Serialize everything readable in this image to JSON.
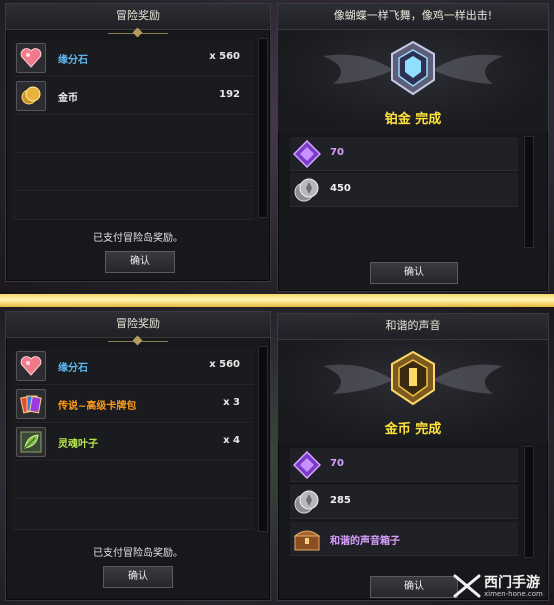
{
  "top_left": {
    "title": "冒险奖励",
    "items": [
      {
        "name": "缘分石",
        "qty": "x 560",
        "icon": "heart-stone-icon"
      },
      {
        "name": "金币",
        "qty": "192",
        "icon": "gold-coin-icon"
      }
    ],
    "paid_text": "已支付冒险岛奖励。",
    "confirm_label": "确认"
  },
  "top_right": {
    "title": "像蝴蝶一样飞舞，像鸡一样出击!",
    "rank_label": "铂金 完成",
    "rewards": [
      {
        "value": "70",
        "icon": "purple-crystal-icon"
      },
      {
        "value": "450",
        "icon": "silver-coin-icon"
      }
    ],
    "confirm_label": "确认"
  },
  "bottom_left": {
    "title": "冒险奖励",
    "items": [
      {
        "name": "缘分石",
        "qty": "x 560",
        "icon": "heart-stone-icon"
      },
      {
        "name": "传说~高级卡牌包",
        "qty": "x 3",
        "icon": "card-pack-icon"
      },
      {
        "name": "灵魂叶子",
        "qty": "x 4",
        "icon": "soul-leaf-icon"
      }
    ],
    "paid_text": "已支付冒险岛奖励。",
    "confirm_label": "确认"
  },
  "bottom_right": {
    "title": "和谐的声音",
    "rank_label": "金币 完成",
    "rewards": [
      {
        "value": "70",
        "icon": "purple-crystal-icon"
      },
      {
        "value": "285",
        "icon": "silver-coin-icon"
      },
      {
        "value": "和谐的声音箱子",
        "icon": "treasure-chest-icon"
      }
    ],
    "confirm_label": "确认"
  },
  "watermark": {
    "brand": "西门手游",
    "url": "ximen-hone.com"
  },
  "colors": {
    "gold_text": "#ffe23a",
    "blue_item": "#5fb8f0",
    "orange_item": "#ff9c1a",
    "green_item": "#b4e64a",
    "purple_value": "#d9a0ff",
    "divider": "#f4d768"
  }
}
